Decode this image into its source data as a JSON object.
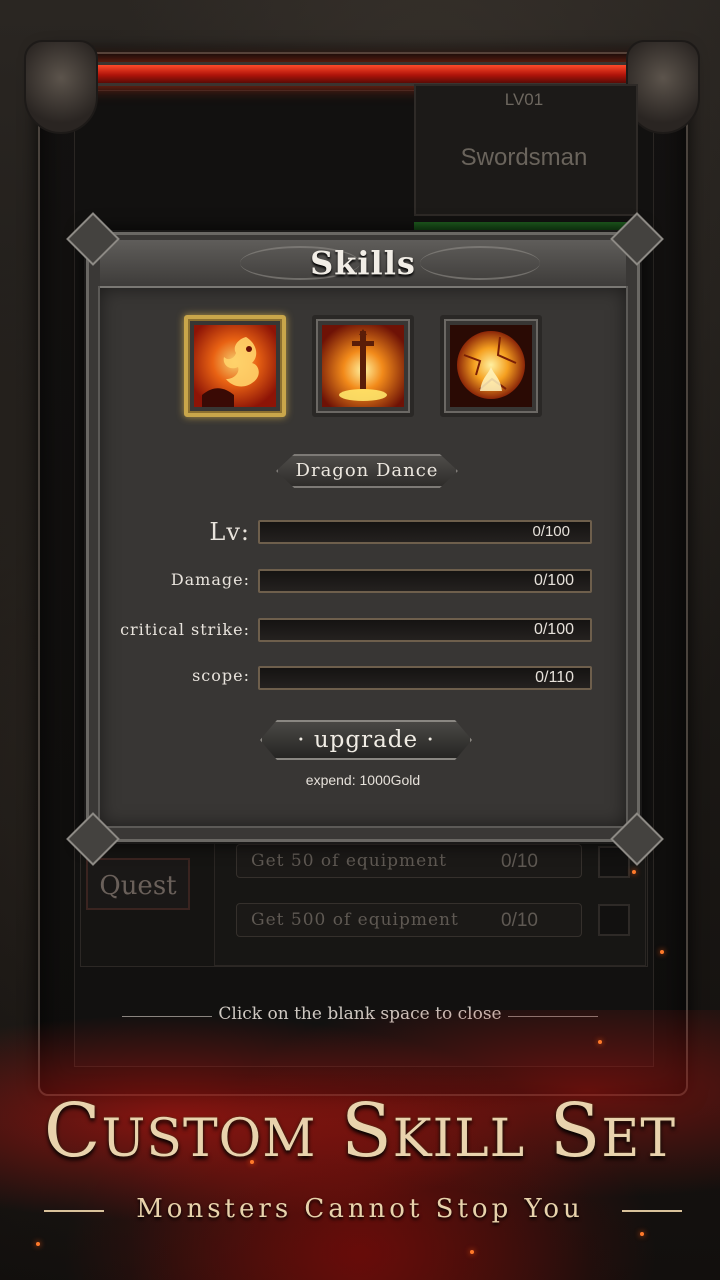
{
  "profile": {
    "level": "LV01",
    "class_name": "Swordsman"
  },
  "quest": {
    "tab_label": "Quest",
    "rows": [
      {
        "label": "Get  50  of  equipment",
        "count": "0/10"
      },
      {
        "label": "Get  500  of  equipment",
        "count": "0/10"
      }
    ]
  },
  "modal": {
    "title": "Skills",
    "skills": [
      {
        "icon": "dragon-fire-skill-icon",
        "selected": true
      },
      {
        "icon": "flaming-sword-skill-icon",
        "selected": false
      },
      {
        "icon": "fire-orb-skill-icon",
        "selected": false
      }
    ],
    "selected_skill_name": "Dragon  Dance",
    "stats": [
      {
        "label": "Lv:",
        "value": "0/100",
        "fraction": 0
      },
      {
        "label": "Damage:",
        "value": "0/100",
        "fraction": 0
      },
      {
        "label": "critical  strike:",
        "value": "0/100",
        "fraction": 0
      },
      {
        "label": "scope:",
        "value": "0/110",
        "fraction": 0
      }
    ],
    "upgrade_label": "· upgrade ·",
    "expend_text": "expend:  1000Gold"
  },
  "close_hint": "Click on the blank space to close",
  "promo": {
    "title": "Custom Skill Set",
    "subtitle": "Monsters Cannot Stop You"
  },
  "colors": {
    "accent_gold": "#c9a64a",
    "frame_red": "#b0140a",
    "text_light": "#ece7df"
  }
}
